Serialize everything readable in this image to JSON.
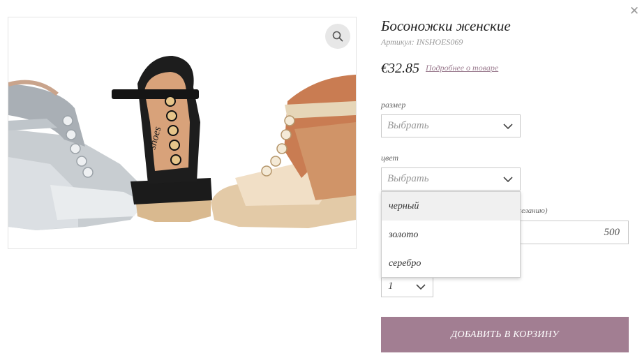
{
  "product": {
    "title": "Босоножки женские",
    "sku_label": "Артикул:",
    "sku_value": "INSHOES069",
    "price": "€32.85",
    "details_link": "Подробнее о товаре",
    "image_brand_text": "shoes"
  },
  "size": {
    "label": "размер",
    "placeholder": "Выбрать"
  },
  "color": {
    "label": "цвет",
    "placeholder": "Выбрать",
    "options": [
      "черный",
      "золото",
      "серебро"
    ]
  },
  "custom_amount": {
    "label_partial": "желанию)",
    "value": "500"
  },
  "quantity": {
    "value": "1"
  },
  "cart": {
    "button_label": "ДОБАВИТЬ В КОРЗИНУ"
  },
  "colors": {
    "accent": "#a27e92",
    "link": "#9c7d90",
    "border": "#c9c9c9"
  },
  "icons": {
    "close": "close-icon",
    "zoom": "search-icon",
    "chevron": "chevron-down-icon"
  }
}
